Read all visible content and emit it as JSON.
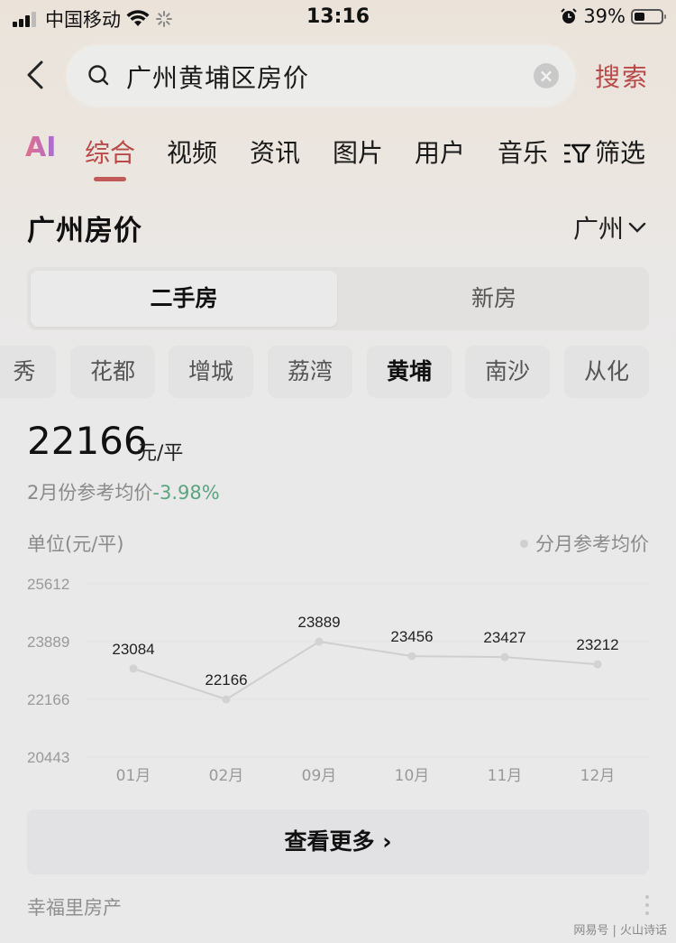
{
  "status_bar": {
    "carrier": "中国移动",
    "time": "13:16",
    "battery_percent_label": "39%",
    "battery_level": 0.39,
    "icons": [
      "signal-icon",
      "wifi-icon",
      "loading-icon",
      "alarm-icon",
      "battery-icon"
    ]
  },
  "search": {
    "back_icon": "chevron-left-icon",
    "search_icon": "search-icon",
    "query": "广州黄埔区房价",
    "clear_icon": "close-icon",
    "submit_label": "搜索"
  },
  "tabs": {
    "items": [
      {
        "label": "AI",
        "active": false
      },
      {
        "label": "综合",
        "active": true
      },
      {
        "label": "视频",
        "active": false
      },
      {
        "label": "资讯",
        "active": false
      },
      {
        "label": "图片",
        "active": false
      },
      {
        "label": "用户",
        "active": false
      },
      {
        "label": "音乐",
        "active": false
      }
    ],
    "filter_label": "筛选",
    "accent_color": "#b84a4a"
  },
  "card": {
    "title": "广州房价",
    "city_select": "广州",
    "segments": [
      {
        "label": "二手房",
        "active": true
      },
      {
        "label": "新房",
        "active": false
      }
    ],
    "districts": [
      {
        "label": "秀",
        "active": false
      },
      {
        "label": "花都",
        "active": false
      },
      {
        "label": "增城",
        "active": false
      },
      {
        "label": "荔湾",
        "active": false
      },
      {
        "label": "黄埔",
        "active": true
      },
      {
        "label": "南沙",
        "active": false
      },
      {
        "label": "从化",
        "active": false
      }
    ],
    "price": "22166",
    "price_unit": "元/平",
    "price_caption": "2月份参考均价",
    "price_change": "-3.98%",
    "change_color": "#5aa580",
    "unit_label": "单位(元/平)",
    "legend_label": "分月参考均价",
    "more_button": "查看更多",
    "source": "幸福里房产",
    "watermark": "网易号 | 火山诗话"
  },
  "chart_data": {
    "type": "line",
    "title": "",
    "xlabel": "",
    "ylabel": "单位(元/平)",
    "categories": [
      "01月",
      "02月",
      "09月",
      "10月",
      "11月",
      "12月"
    ],
    "series": [
      {
        "name": "分月参考均价",
        "values": [
          23084,
          22166,
          23889,
          23456,
          23427,
          23212
        ]
      }
    ],
    "yticks": [
      25612,
      23889,
      22166,
      20443
    ],
    "ylim": [
      20443,
      25612
    ],
    "grid": true,
    "legend_position": "top-right",
    "data_labels": true
  }
}
